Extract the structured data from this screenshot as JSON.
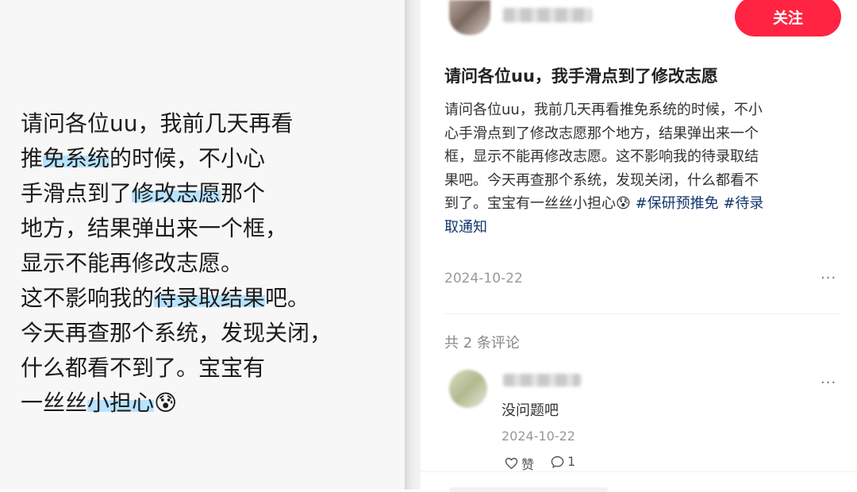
{
  "left_panel": {
    "lines": [
      [
        "请问各位uu，我前几天再看"
      ],
      [
        "推",
        "免系统",
        "的时候，不小心"
      ],
      [
        "手滑点到了",
        "修改志愿",
        "那个"
      ],
      [
        "地方，结果弹出来一个框，"
      ],
      [
        "显示不能再修改志愿。"
      ],
      [
        "这不影响我的",
        "待录取结果",
        "吧。"
      ],
      [
        "今天再查那个系统，发现关闭，"
      ],
      [
        "什么都看不到了。宝宝有"
      ],
      [
        "一丝丝",
        "小担心",
        "😰"
      ]
    ]
  },
  "post": {
    "follow_label": "关注",
    "title": "请问各位uu，我手滑点到了修改志愿",
    "body_lines": [
      "请问各位uu，我前几天再看推免系统的时候，不小",
      "心手滑点到了修改志愿那个地方，结果弹出来一个",
      "框，显示不能再修改志愿。这不影响我的待录取结",
      "果吧。今天再查那个系统，发现关闭，什么都看不",
      "到了。宝宝有一丝丝小担心😰"
    ],
    "tags": [
      "#保研预推免",
      "#待录",
      "取通知"
    ],
    "date": "2024-10-22",
    "more_label": "···"
  },
  "comments": {
    "count_label": "共 2 条评论",
    "items": [
      {
        "text": "没问题吧",
        "date": "2024-10-22",
        "like_label": "赞",
        "reply_count": "1",
        "more_label": "···"
      }
    ]
  },
  "icons": {
    "like": "heart-icon",
    "reply": "comment-bubble-icon",
    "more": "more-dots-icon"
  },
  "colors": {
    "accent": "#ff2442",
    "tag": "#13386c",
    "highlight": "#b8e3ff"
  }
}
